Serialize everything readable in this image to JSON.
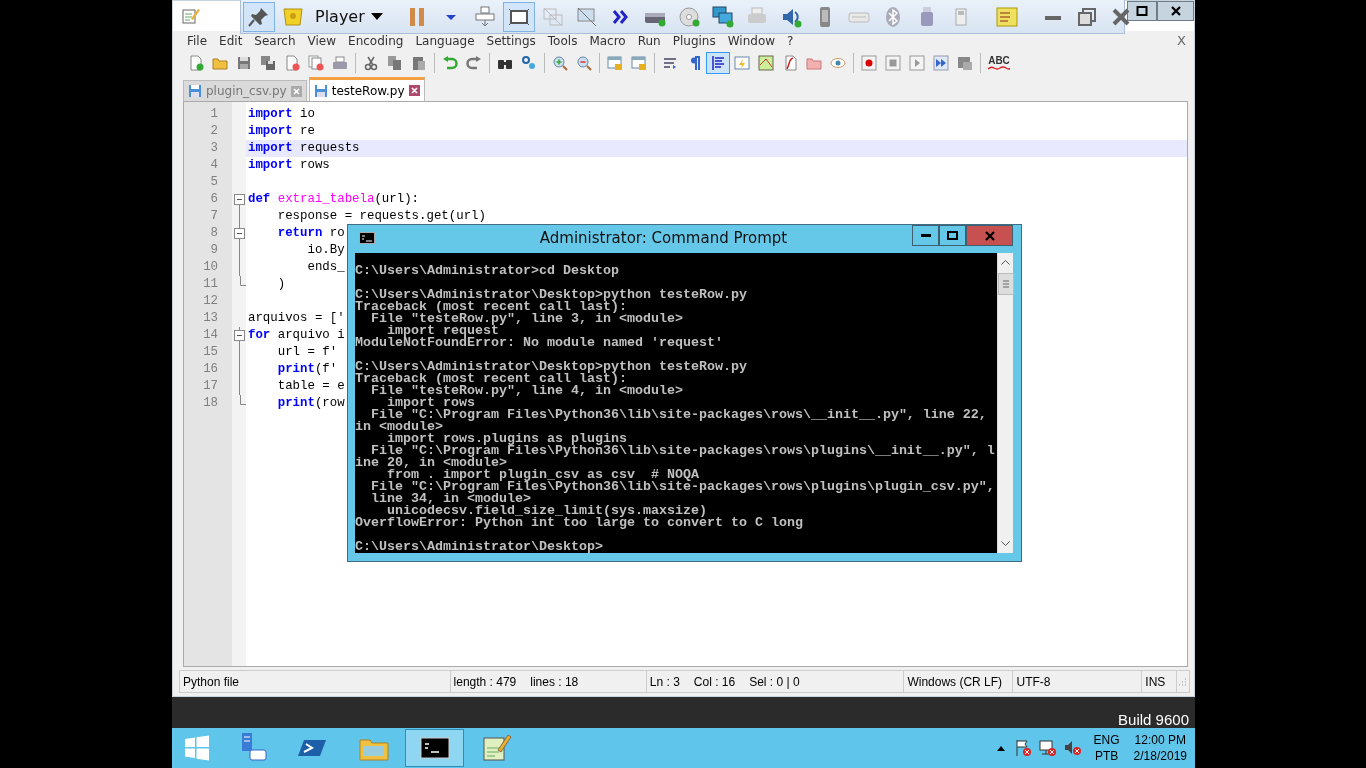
{
  "vm_toolbar": {
    "pin_on": true,
    "menu_label": "Player",
    "fullscreen_on": true
  },
  "menu": [
    "File",
    "Edit",
    "Search",
    "View",
    "Encoding",
    "Language",
    "Settings",
    "Tools",
    "Macro",
    "Run",
    "Plugins",
    "Window",
    "?"
  ],
  "menu_close": "X",
  "toolbar": {
    "indent_guide_on": true,
    "spell_check": "ABC"
  },
  "tabs": [
    {
      "label": "plugin_csv.py",
      "selected": false
    },
    {
      "label": "testeRow.py",
      "selected": true
    }
  ],
  "code": [
    {
      "num": "1",
      "selected": false,
      "kind": "plain",
      "parts": [
        {
          "kind": "keyword",
          "text": "import"
        },
        {
          "kind": "plain",
          "text": " io"
        }
      ]
    },
    {
      "num": "2",
      "selected": false,
      "kind": "plain",
      "parts": [
        {
          "kind": "keyword",
          "text": "import"
        },
        {
          "kind": "plain",
          "text": " re"
        }
      ]
    },
    {
      "num": "3",
      "selected": true,
      "kind": "plain",
      "parts": [
        {
          "kind": "keyword",
          "text": "import"
        },
        {
          "kind": "plain",
          "text": " requests"
        }
      ]
    },
    {
      "num": "4",
      "selected": false,
      "kind": "plain",
      "parts": [
        {
          "kind": "keyword",
          "text": "import"
        },
        {
          "kind": "plain",
          "text": " rows"
        }
      ]
    },
    {
      "num": "5",
      "selected": false,
      "kind": "plain"
    },
    {
      "num": "6",
      "selected": false,
      "kind": "fold-start",
      "parts": [
        {
          "kind": "keyword",
          "text": "def"
        },
        {
          "kind": "name",
          "text": " extrai_tabela"
        },
        {
          "kind": "plain",
          "text": "(url):"
        }
      ]
    },
    {
      "num": "7",
      "selected": false,
      "kind": "fold-body",
      "parts": [
        {
          "kind": "plain",
          "text": "    response = requests.get(url)"
        }
      ]
    },
    {
      "num": "8",
      "selected": false,
      "kind": "fold-start",
      "parts": [
        {
          "kind": "keyword",
          "text": "    return"
        },
        {
          "kind": "plain",
          "text": " ro"
        }
      ]
    },
    {
      "num": "9",
      "selected": false,
      "kind": "fold-body",
      "parts": [
        {
          "kind": "plain",
          "text": "        io.By"
        }
      ]
    },
    {
      "num": "10",
      "selected": false,
      "kind": "fold-body",
      "parts": [
        {
          "kind": "plain",
          "text": "        ends_"
        }
      ]
    },
    {
      "num": "11",
      "selected": false,
      "kind": "fold-end",
      "parts": [
        {
          "kind": "plain",
          "text": "    )"
        }
      ]
    },
    {
      "num": "12",
      "selected": false,
      "kind": "plain"
    },
    {
      "num": "13",
      "selected": false,
      "kind": "plain",
      "parts": [
        {
          "kind": "plain",
          "text": "arquivos = ['"
        }
      ]
    },
    {
      "num": "14",
      "selected": false,
      "kind": "fold-start",
      "parts": [
        {
          "kind": "keyword",
          "text": "for"
        },
        {
          "kind": "plain",
          "text": " arquivo i"
        }
      ]
    },
    {
      "num": "15",
      "selected": false,
      "kind": "fold-body",
      "parts": [
        {
          "kind": "plain",
          "text": "    url = f'"
        }
      ]
    },
    {
      "num": "16",
      "selected": false,
      "kind": "fold-body",
      "parts": [
        {
          "kind": "keyword",
          "text": "    print"
        },
        {
          "kind": "plain",
          "text": "(f'"
        }
      ]
    },
    {
      "num": "17",
      "selected": false,
      "kind": "fold-body",
      "parts": [
        {
          "kind": "plain",
          "text": "    table = e"
        }
      ]
    },
    {
      "num": "18",
      "selected": false,
      "kind": "fold-end",
      "parts": [
        {
          "kind": "keyword",
          "text": "    print"
        },
        {
          "kind": "plain",
          "text": "(row"
        }
      ]
    }
  ],
  "status_bar": [
    [
      "Python file"
    ],
    [
      "length : 479",
      "lines : 18"
    ],
    [
      "Ln : 3",
      "Col : 16",
      "Sel : 0 | 0"
    ],
    [
      "Windows (CR LF)"
    ],
    [
      "UTF-8"
    ],
    [
      "INS"
    ]
  ],
  "console": {
    "title": "Administrator: Command Prompt",
    "blocks": [
      [
        "C:\\Users\\Administrator>cd Desktop"
      ],
      [
        "C:\\Users\\Administrator\\Desktop>python testeRow.py",
        "Traceback (most recent call last):",
        "  File \"testeRow.py\", line 3, in <module>",
        "    import request",
        "ModuleNotFoundError: No module named 'request'"
      ],
      [
        "C:\\Users\\Administrator\\Desktop>python testeRow.py",
        "Traceback (most recent call last):",
        "  File \"testeRow.py\", line 4, in <module>",
        "    import rows",
        "  File \"C:\\Program Files\\Python36\\lib\\site-packages\\rows\\__init__.py\", line 22,",
        "in <module>",
        "    import rows.plugins as plugins",
        "  File \"C:\\Program Files\\Python36\\lib\\site-packages\\rows\\plugins\\__init__.py\", l",
        "ine 20, in <module>",
        "    from . import plugin_csv as csv  # NOQA",
        "  File \"C:\\Program Files\\Python36\\lib\\site-packages\\rows\\plugins\\plugin_csv.py\",",
        "  line 34, in <module>",
        "    unicodecsv.field_size_limit(sys.maxsize)",
        "OverflowError: Python int too large to convert to C long"
      ],
      [
        "C:\\Users\\Administrator\\Desktop>"
      ]
    ]
  },
  "desktop": {
    "build": "Build 9600"
  },
  "taskbar": {
    "apps": [
      {
        "kind": "server-manager",
        "selected": false
      },
      {
        "kind": "powershell",
        "selected": false
      },
      {
        "kind": "explorer",
        "selected": false
      },
      {
        "kind": "console",
        "selected": true
      },
      {
        "kind": "notepad",
        "selected": false
      }
    ],
    "language": [
      "ENG",
      "PTB"
    ],
    "time": "12:00 PM",
    "date": "2/18/2019"
  }
}
